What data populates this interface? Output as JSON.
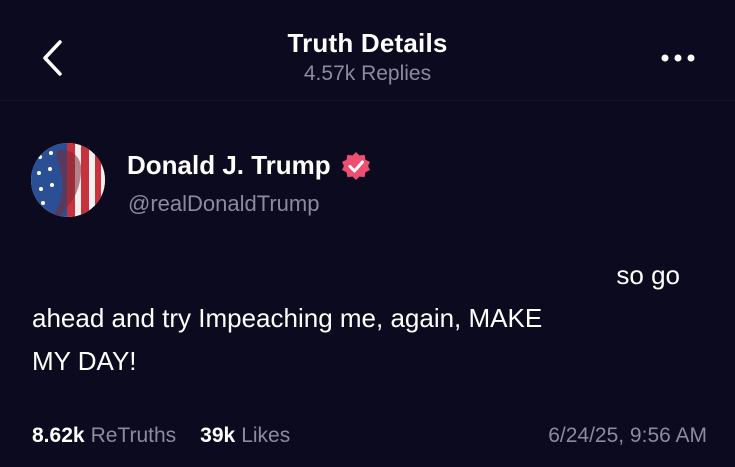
{
  "header": {
    "title": "Truth Details",
    "subtitle": "4.57k Replies",
    "back_icon": "chevron-left-icon",
    "more_icon": "more-horizontal-icon"
  },
  "author": {
    "name": "Donald J. Trump",
    "handle": "@realDonaldTrump",
    "verified_icon": "verified-badge-icon",
    "verified_color": "#ee4e6f"
  },
  "post": {
    "line1": "so go",
    "line2": "ahead and try Impeaching me, again, MAKE",
    "line3": "MY DAY!"
  },
  "stats": {
    "retruths_count": "8.62k",
    "retruths_label": "ReTruths",
    "likes_count": "39k",
    "likes_label": "Likes",
    "timestamp": "6/24/25, 9:56 AM"
  },
  "colors": {
    "background": "#0c0a1e",
    "muted_text": "#8c8a9c",
    "primary_text": "#ffffff"
  }
}
